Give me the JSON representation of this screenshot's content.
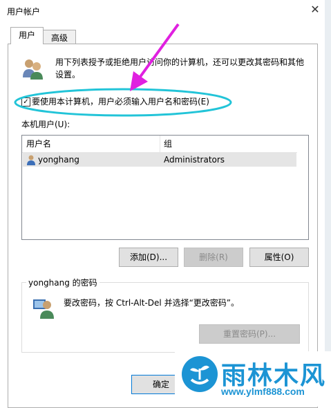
{
  "window": {
    "title": "用户帐户",
    "close_glyph": "✕"
  },
  "tabs": [
    {
      "label": "用户",
      "active": true
    },
    {
      "label": "高级",
      "active": false
    }
  ],
  "intro": {
    "line1": "用下列表授予或拒绝用户访问你的计算机，还可以更改其密码和其他",
    "line2": "设置。"
  },
  "checkbox": {
    "label": "要使用本计算机，用户必须输入用户名和密码(E)",
    "checked": true,
    "mark": "✓"
  },
  "users_label": "本机用户(U):",
  "list": {
    "columns": [
      "用户名",
      "组"
    ],
    "rows": [
      {
        "name": "yonghang",
        "group": "Administrators"
      }
    ]
  },
  "buttons": {
    "add": "添加(D)...",
    "remove": "删除(R)",
    "properties": "属性(O)"
  },
  "password_group": {
    "title": "yonghang 的密码",
    "text": "要改密码，按 Ctrl-Alt-Del 并选择“更改密码”。",
    "reset_button": "重置密码(P)..."
  },
  "footer": {
    "ok": "确定"
  },
  "watermark": {
    "name": "雨林木风",
    "url": "www.ylmf888.com"
  },
  "colors": {
    "annotation_arrow": "#e020e0",
    "annotation_ellipse": "#22c4d8",
    "logo_blue": "#1c94d4"
  }
}
